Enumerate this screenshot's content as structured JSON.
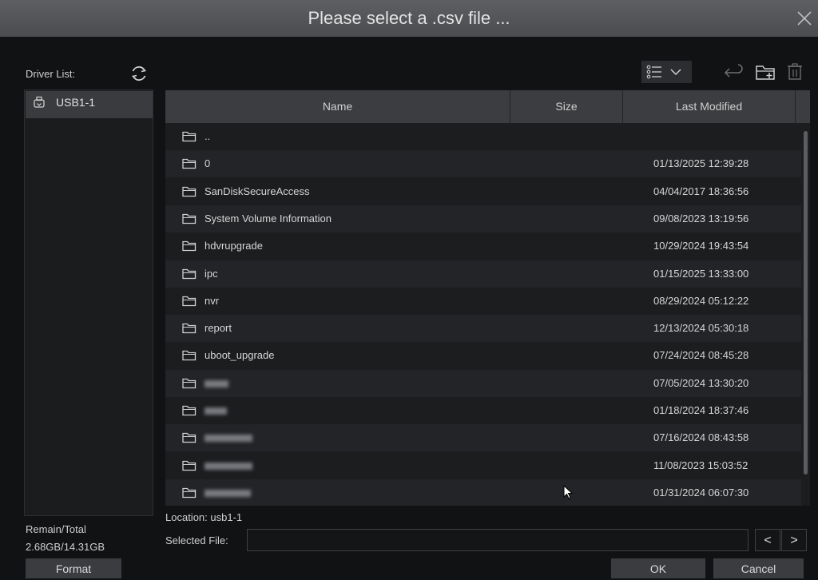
{
  "dialog": {
    "title": "Please select a .csv file ..."
  },
  "drivers": {
    "label": "Driver List:",
    "items": [
      {
        "label": "USB1-1"
      }
    ]
  },
  "storage": {
    "label": "Remain/Total",
    "value": "2.68GB/14.31GB"
  },
  "buttons": {
    "format": "Format",
    "ok": "OK",
    "cancel": "Cancel",
    "prev": "<",
    "next": ">"
  },
  "table": {
    "columns": {
      "name": "Name",
      "size": "Size",
      "modified": "Last Modified"
    },
    "rows": [
      {
        "name": "..",
        "size": "",
        "modified": ""
      },
      {
        "name": "0",
        "size": "",
        "modified": "01/13/2025 12:39:28"
      },
      {
        "name": "SanDiskSecureAccess",
        "size": "",
        "modified": "04/04/2017 18:36:56"
      },
      {
        "name": "System Volume Information",
        "size": "",
        "modified": "09/08/2023 13:19:56"
      },
      {
        "name": "hdvrupgrade",
        "size": "",
        "modified": "10/29/2024 19:43:54"
      },
      {
        "name": "ipc",
        "size": "",
        "modified": "01/15/2025 13:33:00"
      },
      {
        "name": "nvr",
        "size": "",
        "modified": "08/29/2024 05:12:22"
      },
      {
        "name": "report",
        "size": "",
        "modified": "12/13/2024 05:30:18"
      },
      {
        "name": "uboot_upgrade",
        "size": "",
        "modified": "07/24/2024 08:45:28"
      },
      {
        "name": "",
        "size": "",
        "modified": "07/05/2024 13:30:20"
      },
      {
        "name": "",
        "size": "",
        "modified": "01/18/2024 18:37:46"
      },
      {
        "name": "",
        "size": "",
        "modified": "07/16/2024 08:43:58"
      },
      {
        "name": "",
        "size": "",
        "modified": "11/08/2023 15:03:52"
      },
      {
        "name": "",
        "size": "",
        "modified": "01/31/2024 06:07:30"
      }
    ]
  },
  "location": {
    "label": "Location:",
    "value": "usb1-1"
  },
  "selected_file": {
    "label": "Selected File:",
    "value": ""
  },
  "icons": {
    "close": "close-icon",
    "refresh": "refresh-icon",
    "usb": "usb-drive-icon",
    "view": "list-view-icon",
    "back": "back-arrow-icon",
    "new_folder": "new-folder-icon",
    "delete": "trash-icon",
    "folder": "folder-icon"
  }
}
